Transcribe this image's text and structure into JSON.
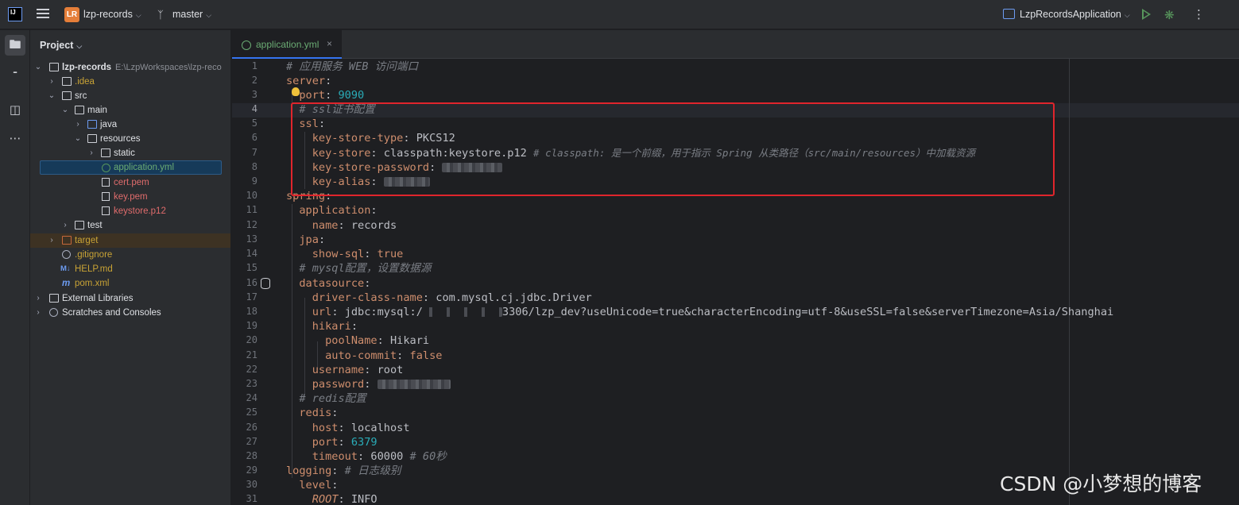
{
  "titlebar": {
    "project_badge": "LR",
    "project_name": "lzp-records",
    "branch": "master",
    "run_config": "LzpRecordsApplication"
  },
  "project_panel": {
    "title": "Project",
    "tree": [
      {
        "label": "lzp-records",
        "path": "E:\\LzpWorkspaces\\lzp-reco",
        "color": "white",
        "bold": true
      },
      {
        "label": ".idea",
        "color": "yellow"
      },
      {
        "label": "src",
        "color": "white"
      },
      {
        "label": "main",
        "color": "white"
      },
      {
        "label": "java",
        "color": "white"
      },
      {
        "label": "resources",
        "color": "white"
      },
      {
        "label": "static",
        "color": "white"
      },
      {
        "label": "application.yml",
        "color": "green"
      },
      {
        "label": "cert.pem",
        "color": "red"
      },
      {
        "label": "key.pem",
        "color": "red"
      },
      {
        "label": "keystore.p12",
        "color": "red"
      },
      {
        "label": "test",
        "color": "white"
      },
      {
        "label": "target",
        "color": "yellow"
      },
      {
        "label": ".gitignore",
        "color": "yellow"
      },
      {
        "label": "HELP.md",
        "color": "yellow"
      },
      {
        "label": "pom.xml",
        "color": "yellow"
      },
      {
        "label": "External Libraries",
        "color": "white"
      },
      {
        "label": "Scratches and Consoles",
        "color": "white"
      }
    ]
  },
  "editor": {
    "tab_label": "application.yml",
    "line_numbers": [
      "1",
      "2",
      "3",
      "4",
      "5",
      "6",
      "7",
      "8",
      "9",
      "10",
      "11",
      "12",
      "13",
      "14",
      "15",
      "16",
      "17",
      "18",
      "19",
      "20",
      "21",
      "22",
      "23",
      "24",
      "25",
      "26",
      "27",
      "28",
      "29",
      "30",
      "31"
    ]
  },
  "code": {
    "l1_comment": "# 应用服务 WEB 访问端口",
    "l2_key": "server",
    "l3_key": "port",
    "l3_val": "9090",
    "l4_comment": "# ssl证书配置",
    "l5_key": "ssl",
    "l6_key": "key-store-type",
    "l6_val": "PKCS12",
    "l7_key": "key-store",
    "l7_val": "classpath:keystore.p12",
    "l7_comment": "# classpath: 是一个前缀，用于指示 Spring 从类路径（src/main/resources）中加载资源",
    "l8_key": "key-store-password",
    "l9_key": "key-alias",
    "l10_key": "spring",
    "l11_key": "application",
    "l12_key": "name",
    "l12_val": "records",
    "l13_key": "jpa",
    "l14_key": "show-sql",
    "l14_val": "true",
    "l15_comment": "# mysql配置，设置数据源",
    "l16_key": "datasource",
    "l17_key": "driver-class-name",
    "l17_val": "com.mysql.cj.jdbc.Driver",
    "l18_key": "url",
    "l18_val_a": "jdbc:mysql:/",
    "l18_val_b": "3306/lzp_dev?useUnicode=true&characterEncoding=utf-8&useSSL=false&serverTimezone=Asia/Shanghai",
    "l19_key": "hikari",
    "l20_key": "poolName",
    "l20_val": "Hikari",
    "l21_key": "auto-commit",
    "l21_val": "false",
    "l22_key": "username",
    "l22_val": "root",
    "l23_key": "password",
    "l24_comment": "# redis配置",
    "l25_key": "redis",
    "l26_key": "host",
    "l26_val": "localhost",
    "l27_key": "port",
    "l27_val": "6379",
    "l28_key": "timeout",
    "l28_val": "60000",
    "l28_comment": "# 60秒",
    "l29_key": "logging",
    "l29_comment": "# 日志级别",
    "l30_key": "level",
    "l31_key": "ROOT",
    "l31_val": "INFO"
  },
  "watermark": "CSDN @小梦想的博客",
  "colors": {
    "highlight_box": "#e0252c",
    "yaml_key": "#cf8e6d",
    "number": "#2aacb8",
    "comment": "#7a7e85"
  }
}
